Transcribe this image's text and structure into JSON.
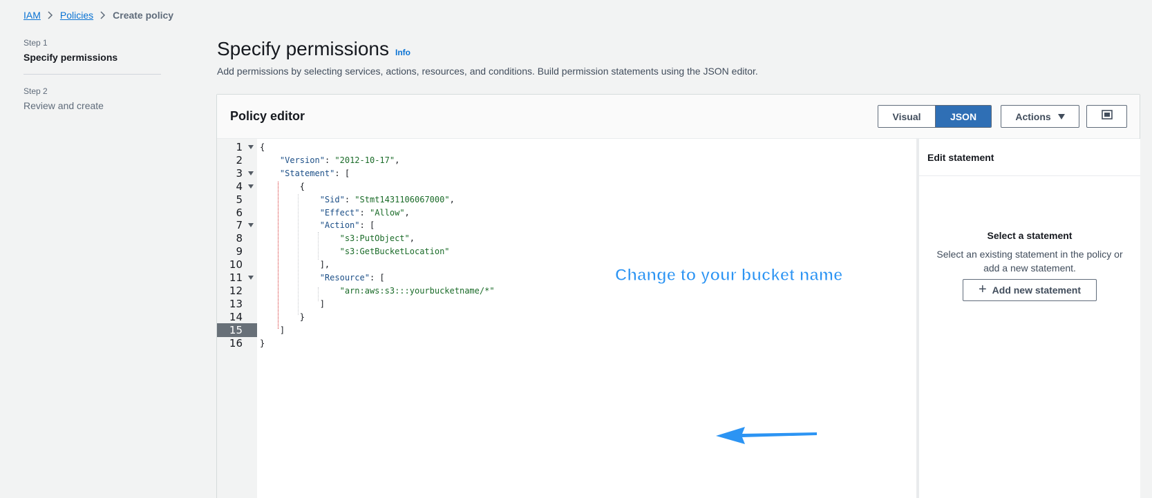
{
  "breadcrumb": {
    "items": [
      "IAM",
      "Policies"
    ],
    "current": "Create policy"
  },
  "steps": [
    {
      "num": "Step 1",
      "title": "Specify permissions"
    },
    {
      "num": "Step 2",
      "title": "Review and create"
    }
  ],
  "header": {
    "title": "Specify permissions",
    "info": "Info",
    "description": "Add permissions by selecting services, actions, resources, and conditions. Build permission statements using the JSON editor."
  },
  "editor": {
    "title": "Policy editor",
    "mode_visual": "Visual",
    "mode_json": "JSON",
    "actions_label": "Actions",
    "active_line": 15,
    "annotation": "Change to your bucket name"
  },
  "side_panel": {
    "header": "Edit statement",
    "empty_title": "Select a statement",
    "empty_desc": "Select an existing statement in the policy or add a new statement.",
    "add_button": "Add new statement"
  },
  "code_lines": [
    "{",
    "    \"Version\": \"2012-10-17\",",
    "    \"Statement\": [",
    "        {",
    "            \"Sid\": \"Stmt1431106067000\",",
    "            \"Effect\": \"Allow\",",
    "            \"Action\": [",
    "                \"s3:PutObject\",",
    "                \"s3:GetBucketLocation\"",
    "            ],",
    "            \"Resource\": [",
    "                \"arn:aws:s3:::yourbucketname/*\"",
    "            ]",
    "        }",
    "    ]",
    "}"
  ],
  "colors": {
    "link": "#0972d3",
    "json_active": "#2f6fb5",
    "annotation": "#2c94f3",
    "string": "#1a6b28",
    "key": "#1c4f87"
  }
}
